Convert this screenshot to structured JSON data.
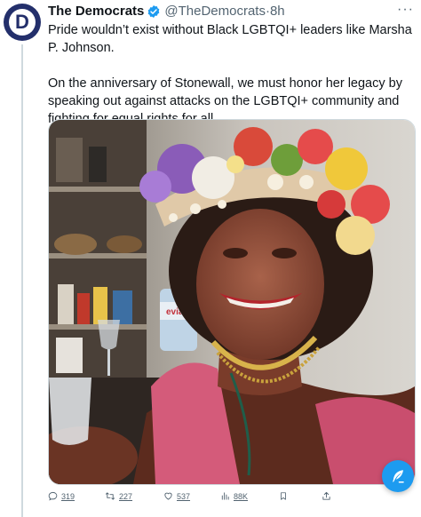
{
  "tweet": {
    "author": "The Democrats",
    "handle": "@TheDemocrats",
    "separator": "·",
    "time": "8h",
    "avatar_letter": "D",
    "more_label": "···",
    "paragraphs": [
      "Pride wouldn’t exist without Black LGBTQI+ leaders like Marsha P. Johnson.",
      "On the anniversary of Stonewall, we must honor her legacy by speaking out against attacks on the LGBTQI+ community and fighting for equal rights for all."
    ],
    "photo_label": "evian"
  },
  "actions": {
    "replies": "319",
    "retweets": "227",
    "likes": "537",
    "views": "88K"
  },
  "icons": {
    "avatar": "democrats-logo-icon",
    "verified": "verified-badge-icon",
    "more": "more-icon",
    "reply": "reply-icon",
    "retweet": "retweet-icon",
    "like": "heart-icon",
    "views": "bar-chart-icon",
    "bookmark": "bookmark-icon",
    "share": "share-icon",
    "compose": "compose-feather-icon"
  },
  "colors": {
    "accent": "#1d9bf0",
    "text": "#0f1419",
    "muted": "#536471",
    "avatar_bg": "#232f6b"
  }
}
